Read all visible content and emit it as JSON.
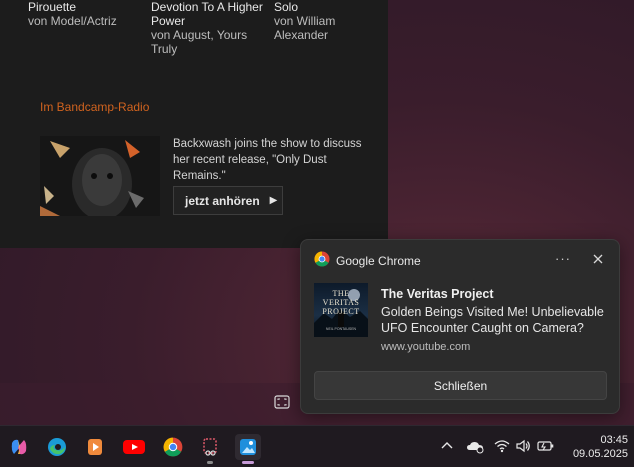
{
  "bandcamp": {
    "albums": [
      {
        "title": "Pirouette",
        "artist": "von Model/Actriz"
      },
      {
        "title_line1": "Devotion To A Higher",
        "title_line2": "Power",
        "artist_line1": "von August, Yours",
        "artist_line2": "Truly"
      },
      {
        "title": "Solo",
        "artist": "von William Alexander"
      }
    ],
    "radio_heading": "Im Bandcamp-Radio",
    "radio_desc": "Backxwash joins the show to discuss her recent release, \"Only Dust Remains.\"",
    "listen_label": "jetzt anhören",
    "accent_color": "#d0631f"
  },
  "notification": {
    "app_name": "Google Chrome",
    "more_label": "···",
    "title": "The Veritas Project",
    "body": "Golden Beings Visited Me! Unbelievable UFO Encounter Caught on Camera?",
    "site": "www.youtube.com",
    "close_button": "Schließen",
    "thumb_title_line1": "THE",
    "thumb_title_line2": "VERITAS",
    "thumb_title_line3": "PROJECT",
    "thumb_subtitle": "NEIL PONTAUSEN"
  },
  "taskbar": {
    "apps": [
      "copilot-icon",
      "edge-icon",
      "media-player-icon",
      "youtube-icon",
      "chrome-icon",
      "snipping-tool-icon",
      "photos-icon"
    ],
    "tray": [
      "chevron-up-icon",
      "onedrive-icon",
      "wifi-icon",
      "volume-icon",
      "battery-icon"
    ],
    "time": "03:45",
    "date": "09.05.2025"
  }
}
